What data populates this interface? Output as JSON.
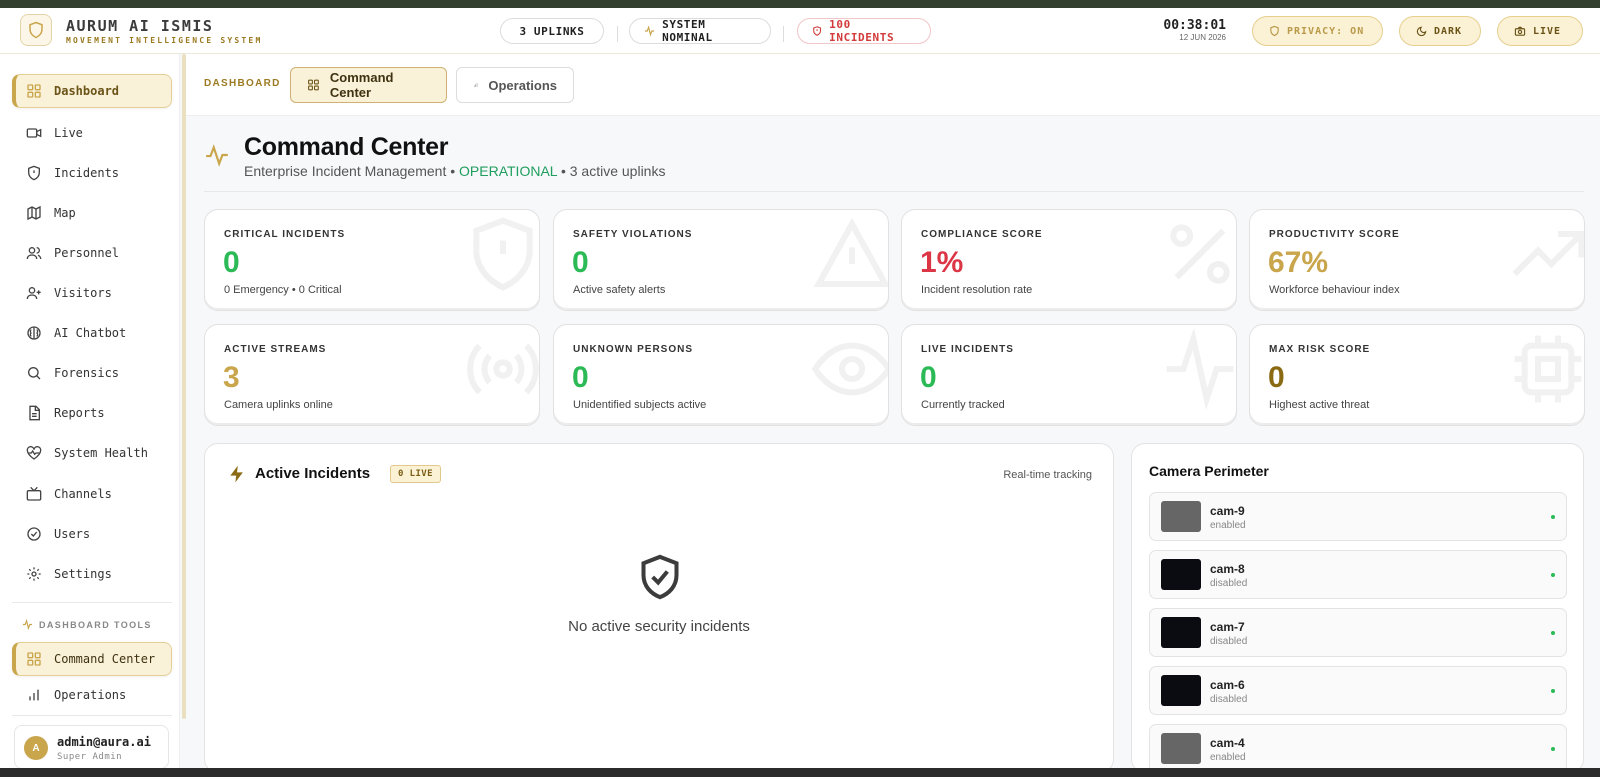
{
  "header": {
    "brand_title": "AURUM AI ISMIS",
    "brand_subtitle": "MOVEMENT INTELLIGENCE SYSTEM",
    "uplinks": "3 UPLINKS",
    "system_status": "SYSTEM NOMINAL",
    "incidents": "100 INCIDENTS",
    "clock_time": "00:38:01",
    "clock_date": "12 JUN 2026",
    "privacy": "PRIVACY: ON",
    "theme": "DARK",
    "live": "LIVE"
  },
  "sidebar": {
    "items": [
      {
        "label": "Dashboard",
        "icon": "grid-icon"
      },
      {
        "label": "Live",
        "icon": "video-icon"
      },
      {
        "label": "Incidents",
        "icon": "shield-alert-icon"
      },
      {
        "label": "Map",
        "icon": "map-icon"
      },
      {
        "label": "Personnel",
        "icon": "users-icon"
      },
      {
        "label": "Visitors",
        "icon": "user-plus-icon"
      },
      {
        "label": "AI Chatbot",
        "icon": "brain-icon"
      },
      {
        "label": "Forensics",
        "icon": "search-icon"
      },
      {
        "label": "Reports",
        "icon": "file-text-icon"
      },
      {
        "label": "System Health",
        "icon": "heart-pulse-icon"
      },
      {
        "label": "Channels",
        "icon": "tv-icon"
      },
      {
        "label": "Users",
        "icon": "check-circle-icon"
      },
      {
        "label": "Settings",
        "icon": "gear-icon"
      }
    ],
    "tools_label": "DASHBOARD TOOLS",
    "tools": [
      {
        "label": "Command Center",
        "icon": "grid-icon"
      },
      {
        "label": "Operations",
        "icon": "bar-chart-icon"
      }
    ],
    "user": {
      "initial": "A",
      "email": "admin@aura.ai",
      "role": "Super Admin"
    }
  },
  "tabbar": {
    "crumb": "DASHBOARD",
    "tabs": [
      {
        "label": "Command Center"
      },
      {
        "label": "Operations"
      }
    ]
  },
  "page": {
    "title": "Command Center",
    "subtitle_prefix": "Enterprise Incident Management •",
    "subtitle_status": "OPERATIONAL",
    "subtitle_suffix": "• 3 active uplinks"
  },
  "stats": [
    {
      "label": "CRITICAL INCIDENTS",
      "value": "0",
      "desc": "0 Emergency • 0 Critical",
      "color": "#2cba56"
    },
    {
      "label": "SAFETY VIOLATIONS",
      "value": "0",
      "desc": "Active safety alerts",
      "color": "#2cba56"
    },
    {
      "label": "COMPLIANCE SCORE",
      "value": "1%",
      "desc": "Incident resolution rate",
      "color": "#dc3545"
    },
    {
      "label": "PRODUCTIVITY SCORE",
      "value": "67%",
      "desc": "Workforce behaviour index",
      "color": "#c9a54b"
    },
    {
      "label": "ACTIVE STREAMS",
      "value": "3",
      "desc": "Camera uplinks online",
      "color": "#c9a54b"
    },
    {
      "label": "UNKNOWN PERSONS",
      "value": "0",
      "desc": "Unidentified subjects active",
      "color": "#2cba56"
    },
    {
      "label": "LIVE INCIDENTS",
      "value": "0",
      "desc": "Currently tracked",
      "color": "#2cba56"
    },
    {
      "label": "MAX RISK SCORE",
      "value": "0",
      "desc": "Highest active threat",
      "color": "#8a6a13"
    }
  ],
  "incidents_panel": {
    "title": "Active Incidents",
    "badge": "0 LIVE",
    "right_label": "Real-time tracking",
    "empty_text": "No active security incidents"
  },
  "camera_panel": {
    "title": "Camera Perimeter",
    "cameras": [
      {
        "name": "cam-9",
        "state": "enabled"
      },
      {
        "name": "cam-8",
        "state": "disabled"
      },
      {
        "name": "cam-7",
        "state": "disabled"
      },
      {
        "name": "cam-6",
        "state": "disabled"
      },
      {
        "name": "cam-4",
        "state": "enabled"
      }
    ]
  }
}
